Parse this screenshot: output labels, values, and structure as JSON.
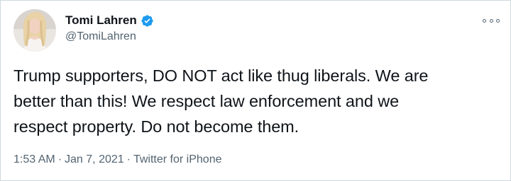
{
  "tweet": {
    "author": {
      "display_name": "Tomi Lahren",
      "handle": "@TomiLahren",
      "verified": true,
      "avatar_icon": "profile-photo"
    },
    "text_lines": [
      "Trump supporters, DO NOT act like thug liberals. We are",
      "better than this! We respect law enforcement and we",
      "respect property. Do not become them."
    ],
    "time": "1:53 AM",
    "date": "Jan 7, 2021",
    "source": "Twitter for iPhone",
    "separator": "·",
    "more_icon": "more-horizontal-icon"
  },
  "colors": {
    "text": "#0f1419",
    "muted": "#536471",
    "verified": "#1d9bf0",
    "border": "#cfd9de"
  }
}
